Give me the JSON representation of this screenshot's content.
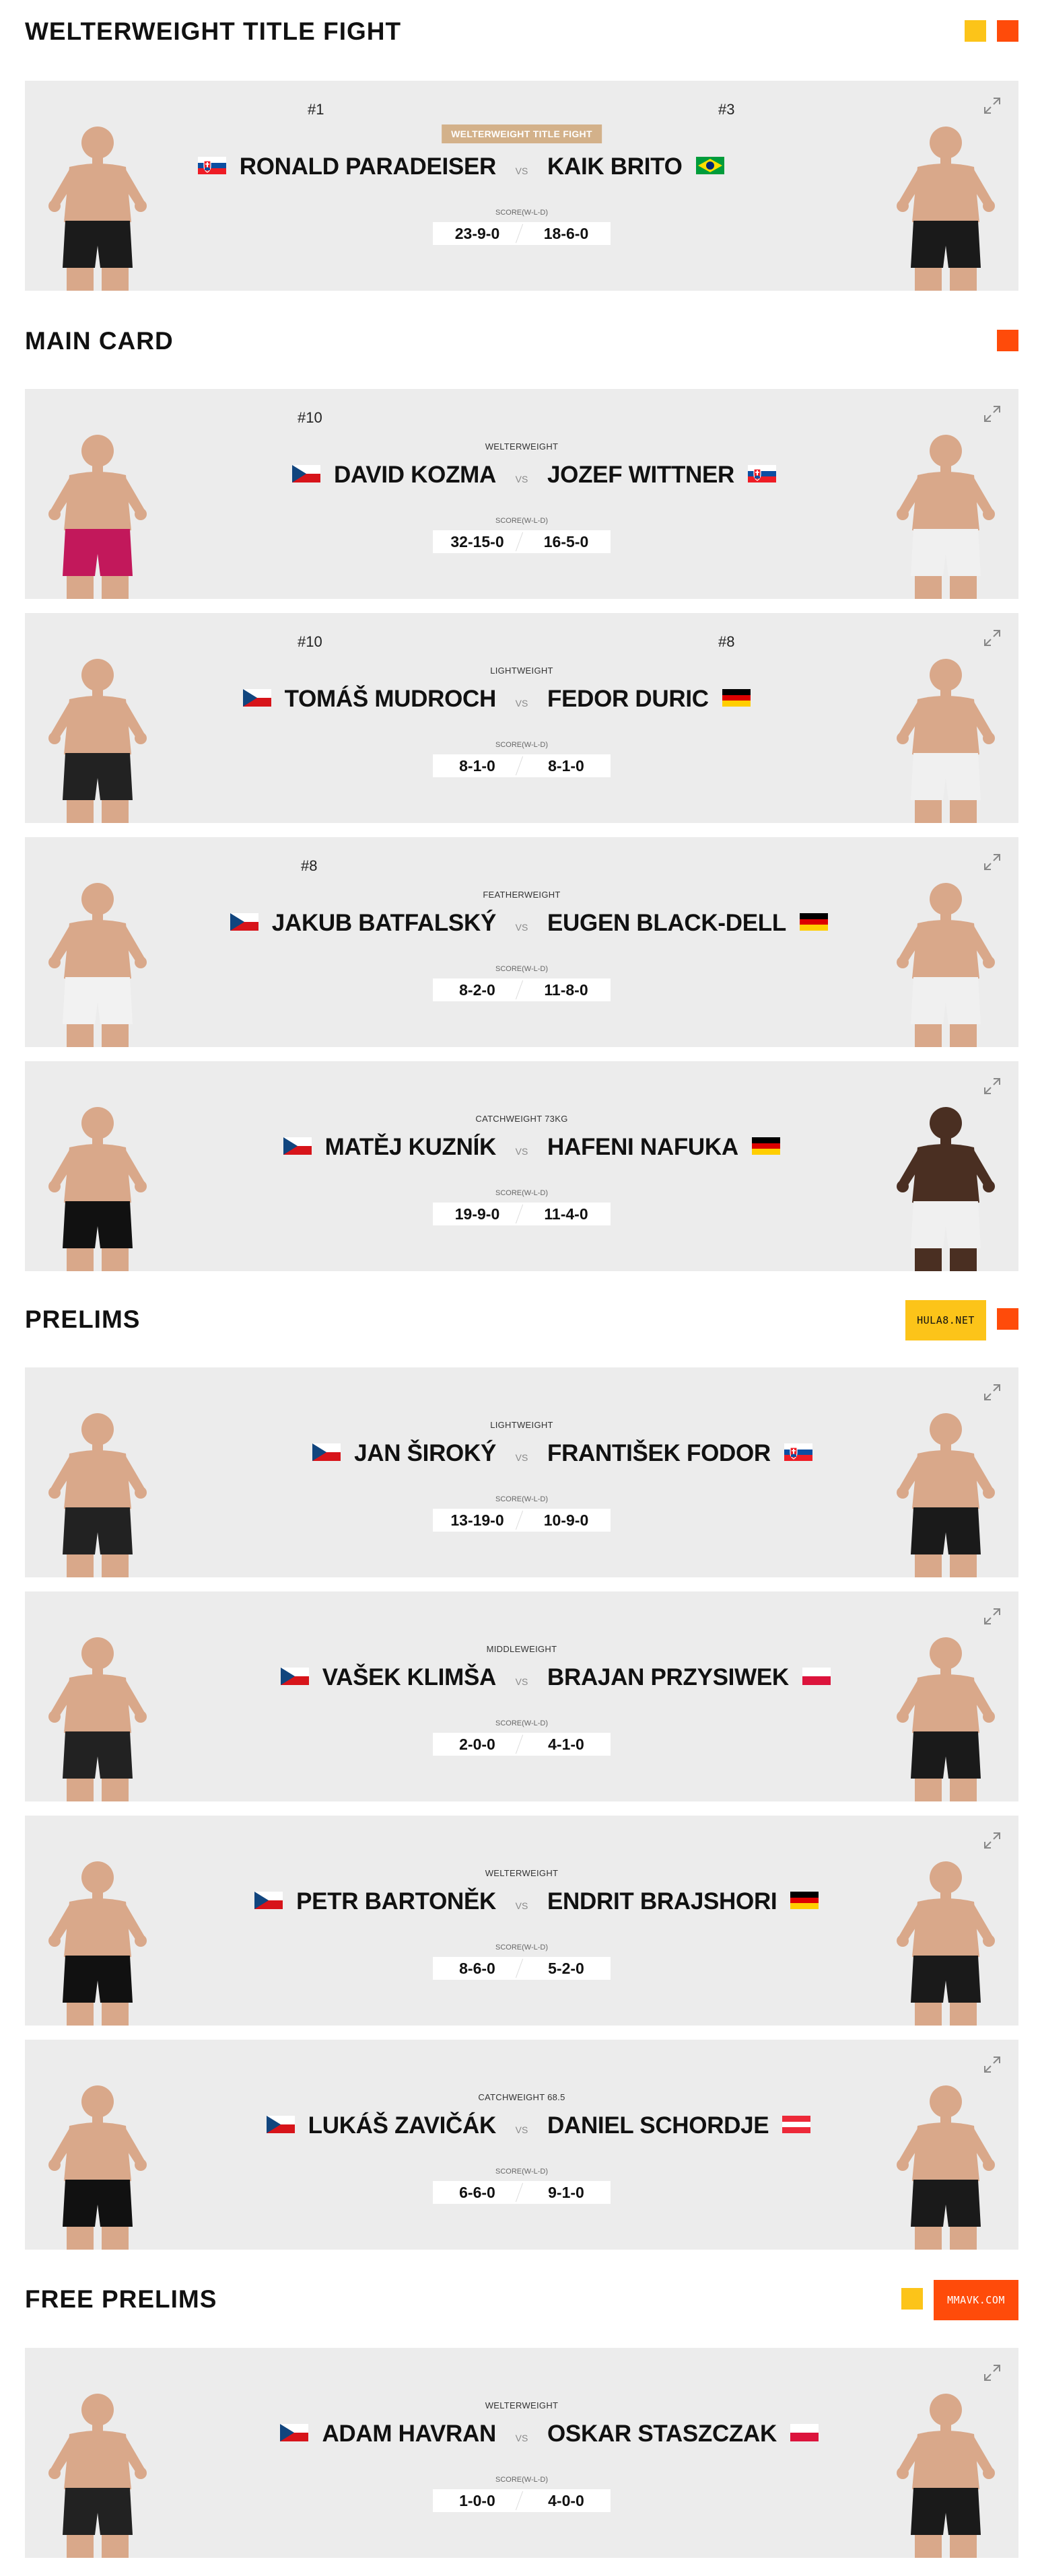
{
  "sections": {
    "title_fight": {
      "title": "WELTERWEIGHT TITLE FIGHT"
    },
    "main_card": {
      "title": "MAIN CARD"
    },
    "prelims": {
      "title": "PRELIMS",
      "button": "HULA8.NET"
    },
    "free_prelims": {
      "title": "FREE PRELIMS",
      "button": "MMAVK.COM"
    }
  },
  "colors": {
    "accent_orange": "#ff4b0a",
    "accent_yellow": "#fcc419",
    "title_badge": "#d3b18a",
    "card_bg": "#ececec"
  },
  "vs_label": "VS",
  "score_label": "SCORE(W-L-D)",
  "fights": [
    {
      "rank_left": "#1",
      "rank_right": "#3",
      "weight": "WELTERWEIGHT TITLE FIGHT",
      "left": {
        "name": "RONALD PARADEISER",
        "flag": "sk",
        "record": "23-9-0"
      },
      "right": {
        "name": "KAIK BRITO",
        "flag": "br",
        "record": "18-6-0"
      }
    },
    {
      "rank_left": "#10",
      "rank_right": "",
      "weight": "WELTERWEIGHT",
      "left": {
        "name": "DAVID KOZMA",
        "flag": "cz",
        "record": "32-15-0"
      },
      "right": {
        "name": "JOZEF WITTNER",
        "flag": "sk",
        "record": "16-5-0"
      }
    },
    {
      "rank_left": "#10",
      "rank_right": "#8",
      "weight": "LIGHTWEIGHT",
      "left": {
        "name": "TOMÁŠ MUDROCH",
        "flag": "cz",
        "record": "8-1-0"
      },
      "right": {
        "name": "FEDOR DURIC",
        "flag": "de",
        "record": "8-1-0"
      }
    },
    {
      "rank_left": "#8",
      "rank_right": "",
      "weight": "FEATHERWEIGHT",
      "left": {
        "name": "JAKUB BATFALSKÝ",
        "flag": "cz",
        "record": "8-2-0"
      },
      "right": {
        "name": "EUGEN BLACK-DELL",
        "flag": "de",
        "record": "11-8-0"
      }
    },
    {
      "rank_left": "",
      "rank_right": "",
      "weight": "CATCHWEIGHT 73KG",
      "left": {
        "name": "MATĚJ KUZNÍK",
        "flag": "cz",
        "record": "19-9-0"
      },
      "right": {
        "name": "HAFENI NAFUKA",
        "flag": "de",
        "record": "11-4-0"
      }
    },
    {
      "rank_left": "",
      "rank_right": "",
      "weight": "LIGHTWEIGHT",
      "left": {
        "name": "JAN ŠIROKÝ",
        "flag": "cz",
        "record": "13-19-0"
      },
      "right": {
        "name": "FRANTIŠEK FODOR",
        "flag": "sk",
        "record": "10-9-0"
      }
    },
    {
      "rank_left": "",
      "rank_right": "",
      "weight": "MIDDLEWEIGHT",
      "left": {
        "name": "VAŠEK KLIMŠA",
        "flag": "cz",
        "record": "2-0-0"
      },
      "right": {
        "name": "BRAJAN PRZYSIWEK",
        "flag": "pl",
        "record": "4-1-0"
      }
    },
    {
      "rank_left": "",
      "rank_right": "",
      "weight": "WELTERWEIGHT",
      "left": {
        "name": "PETR BARTONĚK",
        "flag": "cz",
        "record": "8-6-0"
      },
      "right": {
        "name": "ENDRIT BRAJSHORI",
        "flag": "de",
        "record": "5-2-0"
      }
    },
    {
      "rank_left": "",
      "rank_right": "",
      "weight": "CATCHWEIGHT 68.5",
      "left": {
        "name": "LUKÁŠ ZAVIČÁK",
        "flag": "cz",
        "record": "6-6-0"
      },
      "right": {
        "name": "DANIEL SCHORDJE",
        "flag": "at",
        "record": "9-1-0"
      }
    },
    {
      "rank_left": "",
      "rank_right": "",
      "weight": "WELTERWEIGHT",
      "left": {
        "name": "ADAM HAVRAN",
        "flag": "cz",
        "record": "1-0-0"
      },
      "right": {
        "name": "OSKAR STASZCZAK",
        "flag": "pl",
        "record": "4-0-0"
      }
    }
  ]
}
